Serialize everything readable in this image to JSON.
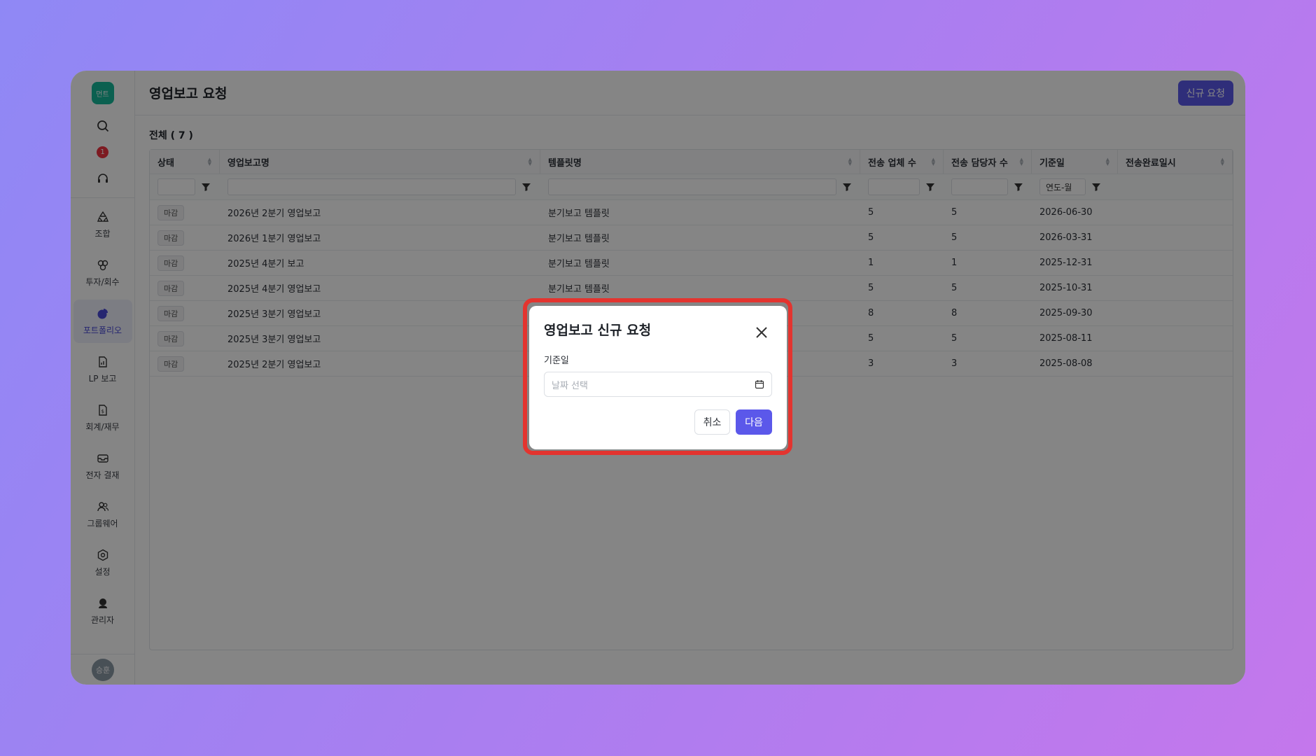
{
  "sidebar": {
    "logo_text": "먼트",
    "notification_count": "1",
    "items": [
      {
        "label": "조합",
        "icon": "recycle-icon"
      },
      {
        "label": "투자/회수",
        "icon": "links-icon"
      },
      {
        "label": "포트폴리오",
        "icon": "pie-chart-icon",
        "active": true
      },
      {
        "label": "LP 보고",
        "icon": "report-file-icon"
      },
      {
        "label": "회계/재무",
        "icon": "finance-file-icon"
      },
      {
        "label": "전자 결재",
        "icon": "inbox-icon"
      },
      {
        "label": "그룹웨어",
        "icon": "users-icon"
      },
      {
        "label": "설정",
        "icon": "gear-icon"
      },
      {
        "label": "관리자",
        "icon": "admin-icon"
      }
    ],
    "user_avatar": "승훈"
  },
  "header": {
    "title": "영업보고 요청",
    "new_request_button": "신규 요청"
  },
  "list": {
    "count_label": "전체 ( 7 )",
    "columns": [
      "상태",
      "영업보고명",
      "템플릿명",
      "전송 업체 수",
      "전송 담당자 수",
      "기준일",
      "전송완료일시"
    ],
    "date_filter_placeholder": "연도-월",
    "rows": [
      {
        "status": "마감",
        "name": "2026년 2분기 영업보고",
        "template": "분기보고 템플릿",
        "companies": "5",
        "contacts": "5",
        "base_date": "2026-06-30",
        "sent_at": ""
      },
      {
        "status": "마감",
        "name": "2026년 1분기 영업보고",
        "template": "분기보고 템플릿",
        "companies": "5",
        "contacts": "5",
        "base_date": "2026-03-31",
        "sent_at": ""
      },
      {
        "status": "마감",
        "name": "2025년 4분기 보고",
        "template": "분기보고 템플릿",
        "companies": "1",
        "contacts": "1",
        "base_date": "2025-12-31",
        "sent_at": ""
      },
      {
        "status": "마감",
        "name": "2025년 4분기 영업보고",
        "template": "분기보고 템플릿",
        "companies": "5",
        "contacts": "5",
        "base_date": "2025-10-31",
        "sent_at": ""
      },
      {
        "status": "마감",
        "name": "2025년 3분기 영업보고",
        "template": "",
        "companies": "8",
        "contacts": "8",
        "base_date": "2025-09-30",
        "sent_at": ""
      },
      {
        "status": "마감",
        "name": "2025년 3분기 영업보고",
        "template": "",
        "companies": "5",
        "contacts": "5",
        "base_date": "2025-08-11",
        "sent_at": ""
      },
      {
        "status": "마감",
        "name": "2025년 2분기 영업보고",
        "template": "",
        "companies": "3",
        "contacts": "3",
        "base_date": "2025-08-08",
        "sent_at": ""
      }
    ]
  },
  "modal": {
    "title": "영업보고 신규 요청",
    "date_label": "기준일",
    "date_placeholder": "날짜 선택",
    "cancel_button": "취소",
    "next_button": "다음",
    "highlight_color": "#e3342f"
  },
  "colors": {
    "accent": "#5b58ea",
    "logo": "#16b89a",
    "badge": "#ef3340"
  }
}
